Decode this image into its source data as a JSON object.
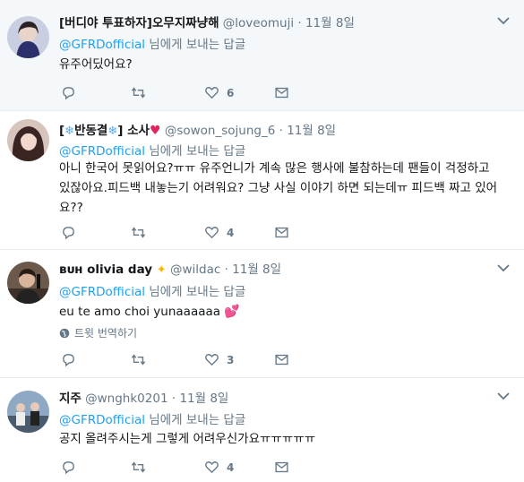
{
  "tweets": [
    {
      "display_name": "[버디야 투표하자]오무지짜냥해",
      "handle": "@loveomuji",
      "dot": "·",
      "time": "11월 8일",
      "reply_mention": "@GFRDofficial",
      "reply_suffix": " 님에게 보내는 답글",
      "text": "유주어딨어요?",
      "likes": "6"
    },
    {
      "display_name_pre": "[",
      "display_name_mid": "반동결",
      "display_name_post": "] 소사",
      "handle": "@sowon_sojung_6",
      "dot": "·",
      "time": "11월 8일",
      "reply_mention": "@GFRDofficial",
      "reply_suffix": " 님에게 보내는 답글",
      "text": "아니 한국어 못읽어요?ㅠㅠ 유주언니가 계속 많은 행사에 불참하는데 팬들이 걱정하고 있잖아요.피드백 내놓는기 어려워요? 그냥 사실 이야기 하면 되는데ㅠ 피드백 짜고 있어요??",
      "likes": "4"
    },
    {
      "display_name": "ʙᴜʜ olivia day",
      "handle": "@wildac",
      "dot": "·",
      "time": "11월 8일",
      "reply_mention": "@GFRDofficial",
      "reply_suffix": " 님에게 보내는 답글",
      "text": "eu te amo choi yunaaaaaa",
      "translate_label": "트윗 번역하기",
      "likes": "3"
    },
    {
      "display_name": "지주",
      "handle": "@wnghk0201",
      "dot": "·",
      "time": "11월 8일",
      "reply_mention": "@GFRDofficial",
      "reply_suffix": " 님에게 보내는 답글",
      "text": "공지 올려주시는게 그렇게 어려우신가요ㅠㅠㅠㅠㅠ",
      "likes": "4"
    }
  ],
  "icons": {
    "reply": "reply-icon",
    "retweet": "retweet-icon",
    "like": "heart-icon",
    "dm": "direct-message-icon",
    "more": "chevron-down-icon",
    "globe": "globe-icon"
  },
  "colors": {
    "link": "#1da1f2",
    "muted": "#657786",
    "highlight_bg": "#f5f8fa",
    "heart": "#e0245e"
  }
}
